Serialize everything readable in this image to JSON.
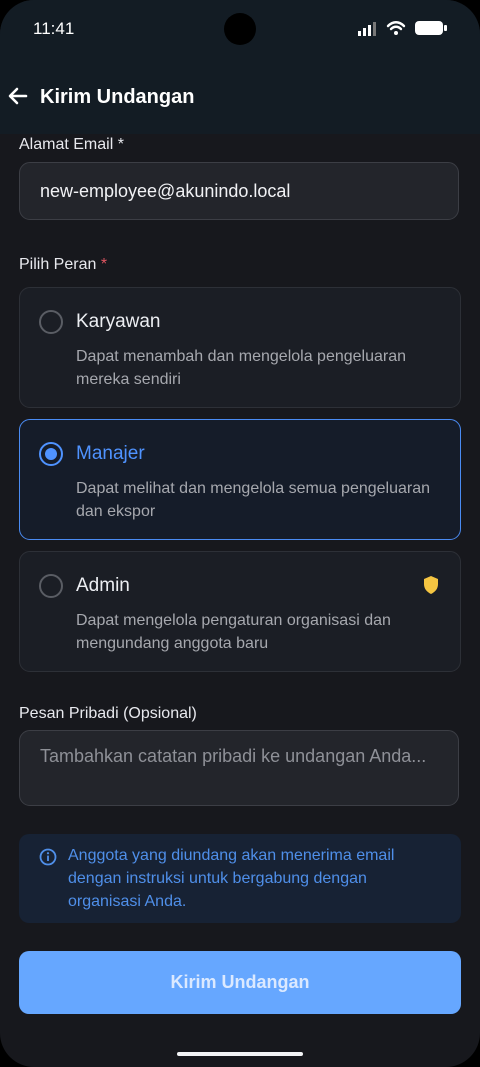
{
  "status": {
    "time": "11:41",
    "icons": [
      "signal-icon",
      "wifi-icon",
      "battery-icon"
    ]
  },
  "header": {
    "title": "Kirim Undangan",
    "back_icon": "arrow-left-icon"
  },
  "form": {
    "email_label": "Alamat Email *",
    "email_value": "new-employee@akunindo.local",
    "role_label": "Pilih Peran",
    "required_mark": "*",
    "roles": [
      {
        "title": "Karyawan",
        "description": "Dapat menambah dan mengelola pengeluaran mereka sendiri",
        "selected": false
      },
      {
        "title": "Manajer",
        "description": "Dapat melihat dan mengelola semua pengeluaran dan ekspor",
        "selected": true
      },
      {
        "title": "Admin",
        "description": "Dapat mengelola pengaturan organisasi dan mengundang anggota baru",
        "selected": false,
        "badge_icon": "shield-icon"
      }
    ],
    "message_label": "Pesan Pribadi (Opsional)",
    "message_placeholder": "Tambahkan catatan pribadi ke undangan Anda...",
    "info_text": "Anggota yang diundang akan menerima email dengan instruksi untuk bergabung dengan organisasi Anda.",
    "submit_label": "Kirim Undangan"
  },
  "colors": {
    "accent": "#4f93ff",
    "button": "#66a7ff",
    "warning_badge": "#f5c542",
    "required": "#e05561"
  }
}
